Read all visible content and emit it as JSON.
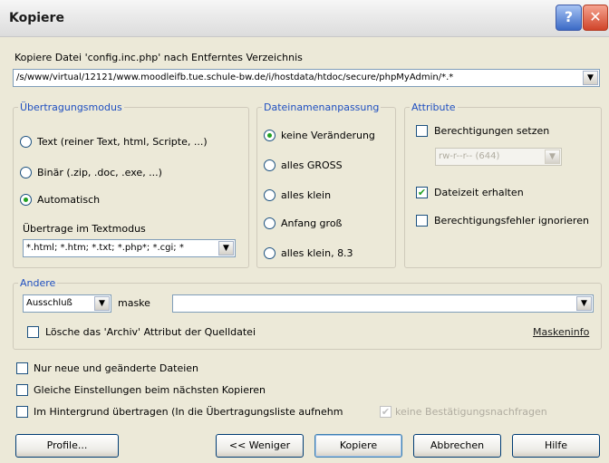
{
  "window": {
    "title": "Kopiere",
    "help_glyph": "?",
    "close_glyph": "✕"
  },
  "copy_label": "Kopiere Datei 'config.inc.php' nach Entferntes Verzeichnis",
  "target_path": "/s/www/virtual/12121/www.moodleifb.tue.schule-bw.de/i/hostdata/htdoc/secure/phpMyAdmin/*.*",
  "groups": {
    "transfer_mode": {
      "title": "Übertragungsmodus",
      "options": [
        "Text (reiner Text, html, Scripte, ...)",
        "Binär (.zip, .doc, .exe, ...)",
        "Automatisch"
      ],
      "selected": 2,
      "textmode_label": "Übertrage im Textmodus",
      "textmode_value": "*.html; *.htm; *.txt; *.php*; *.cgi; *"
    },
    "filename_case": {
      "title": "Dateinamenanpassung",
      "options": [
        "keine Veränderung",
        "alles GROSS",
        "alles klein",
        "Anfang groß",
        "alles klein, 8.3"
      ],
      "selected": 0
    },
    "attributes": {
      "title": "Attribute",
      "set_permissions": "Berechtigungen setzen",
      "permissions_value": "rw-r--r-- (644)",
      "keep_date": "Dateizeit erhalten",
      "ignore_errors": "Berechtigungsfehler ignorieren"
    },
    "other": {
      "title": "Andere",
      "filter_mode": "Ausschluß",
      "mask_label": "maske",
      "mask_value": "",
      "archive_label": "Lösche das 'Archiv' Attribut der Quelldatei",
      "mask_info": "Maskeninfo"
    }
  },
  "options": {
    "new_only": "Nur neue und geänderte Dateien",
    "same_settings": "Gleiche Einstellungen beim nächsten Kopieren",
    "background": "Im Hintergrund übertragen (In die Übertragungsliste aufnehm",
    "no_confirm": "keine Bestätigungsnachfragen"
  },
  "buttons": {
    "profiles": "Profile...",
    "less": "<< Weniger",
    "copy": "Kopiere",
    "cancel": "Abbrechen",
    "help": "Hilfe"
  },
  "colors": {
    "group_title": "#1f4fc0",
    "dialog_bg": "#ece9d8",
    "check_mark": "#21a121"
  }
}
